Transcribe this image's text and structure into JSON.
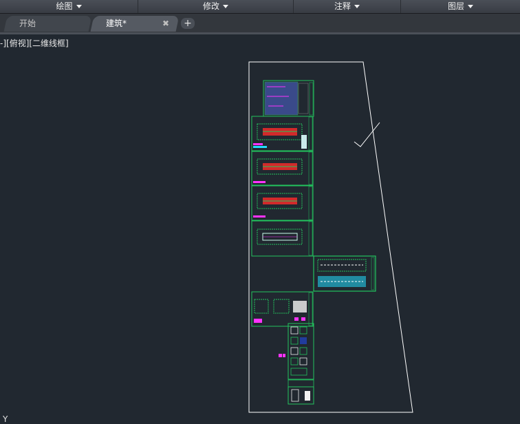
{
  "ribbon": {
    "panels": [
      {
        "label": "绘图"
      },
      {
        "label": "修改"
      },
      {
        "label": "注释"
      },
      {
        "label": "图层"
      }
    ]
  },
  "tabs": {
    "start_label": "开始",
    "active_label": "建筑*",
    "close_glyph": "✖",
    "add_glyph": "+"
  },
  "viewport": {
    "view_label": "-][俯视][二维线框]",
    "ucs_label": "Y"
  },
  "colors": {
    "background": "#212830",
    "line_white": "#ffffff",
    "drawing_green": "#22c55e",
    "drawing_red": "#ff2a2a",
    "drawing_magenta": "#ff33ff",
    "drawing_cyan": "#22ddff",
    "drawing_blue": "#3355aa"
  }
}
